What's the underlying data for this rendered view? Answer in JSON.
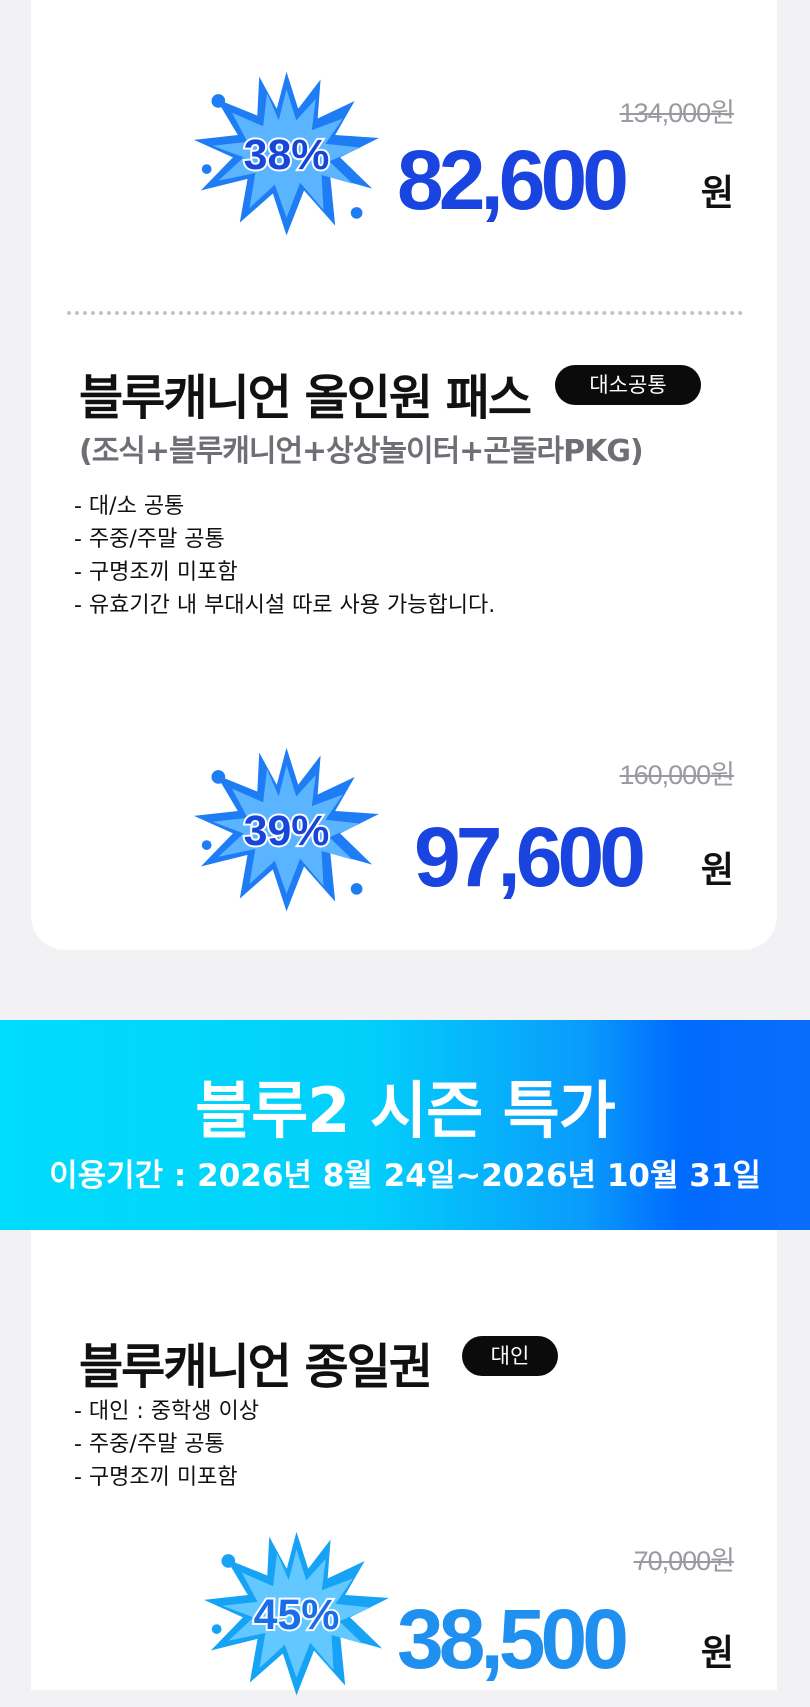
{
  "colors": {
    "price_blue": "#1a44df",
    "price_sky": "#1f8ff0",
    "splash_blue": "#2d86ff",
    "banner_start": "#00dcfb",
    "banner_end": "#006bff"
  },
  "offer1_tail": {
    "discount": "38%",
    "original_price": "134,000원",
    "price": "82,600",
    "currency": "원"
  },
  "offer2": {
    "title": "블루캐니언 올인원 패스",
    "badge": "대소공통",
    "subtitle": "(조식+블루캐니언+상상놀이터+곤돌라PKG)",
    "bullets": [
      "- 대/소 공통",
      "- 주중/주말 공통",
      "- 구명조끼 미포함",
      "- 유효기간 내 부대시설 따로 사용 가능합니다."
    ],
    "discount": "39%",
    "original_price": "160,000원",
    "price": "97,600",
    "currency": "원"
  },
  "season_banner": {
    "title": "블루2 시즌 특가",
    "period": "이용기간 : 2026년 8월 24일~2026년 10월 31일"
  },
  "offer3": {
    "title": "블루캐니언 종일권",
    "badge": "대인",
    "bullets": [
      "- 대인 : 중학생 이상",
      "- 주중/주말 공통",
      "- 구명조끼 미포함"
    ],
    "discount": "45%",
    "original_price": "70,000원",
    "price": "38,500",
    "currency": "원"
  }
}
